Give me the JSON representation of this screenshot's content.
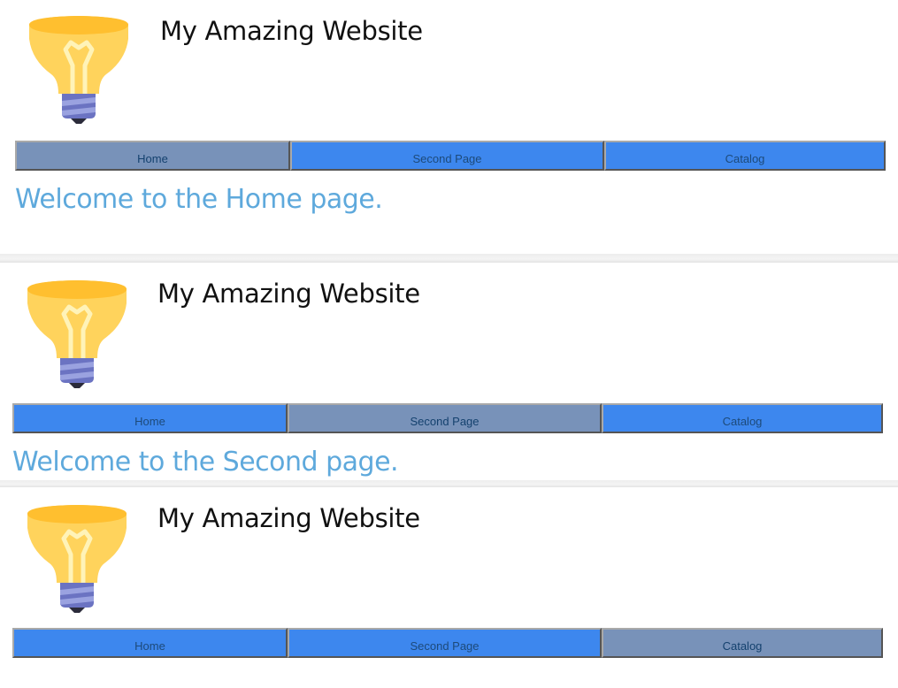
{
  "colors": {
    "nav_default": "#3d87ee",
    "nav_active": "#7892b9",
    "nav_text": "#1d4a7a",
    "welcome_text": "#5ea9dc",
    "title_text": "#111111",
    "bulb_top": "#ffbf2f",
    "bulb_body": "#ffd35c",
    "filament": "#fff3b8",
    "bulb_base": "#6b73c2",
    "base_stripe": "#9aa2e0"
  },
  "panels": [
    {
      "logo_icon": "lightbulb-icon",
      "site_title": "My Amazing Website",
      "nav": {
        "home_label": "Home",
        "second_label": "Second Page",
        "catalog_label": "Catalog",
        "active": "home"
      },
      "welcome": "Welcome to the Home page."
    },
    {
      "logo_icon": "lightbulb-icon",
      "site_title": "My Amazing Website",
      "nav": {
        "home_label": "Home",
        "second_label": "Second Page",
        "catalog_label": "Catalog",
        "active": "second"
      },
      "welcome": "Welcome to the Second page."
    },
    {
      "logo_icon": "lightbulb-icon",
      "site_title": "My Amazing Website",
      "nav": {
        "home_label": "Home",
        "second_label": "Second Page",
        "catalog_label": "Catalog",
        "active": "catalog"
      },
      "welcome": ""
    }
  ]
}
